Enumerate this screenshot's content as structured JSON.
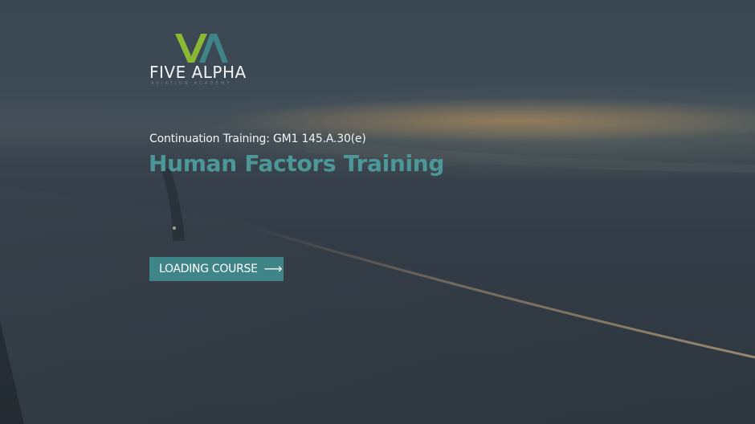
{
  "logo": {
    "name": "FIVE ALPHA",
    "tagline": "AVIATION ACADEMY",
    "colors": {
      "green": "#8ab833",
      "teal": "#3f8486"
    }
  },
  "course": {
    "subtitle": "Continuation Training: GM1 145.A.30(e)",
    "title": "Human Factors Training"
  },
  "button": {
    "label": "LOADING COURSE",
    "icon": "arrow-right-icon",
    "arrow_glyph": "⟶",
    "color": "#3f8486"
  },
  "background": {
    "description_icon": "airplane-wing-sunset-image"
  }
}
